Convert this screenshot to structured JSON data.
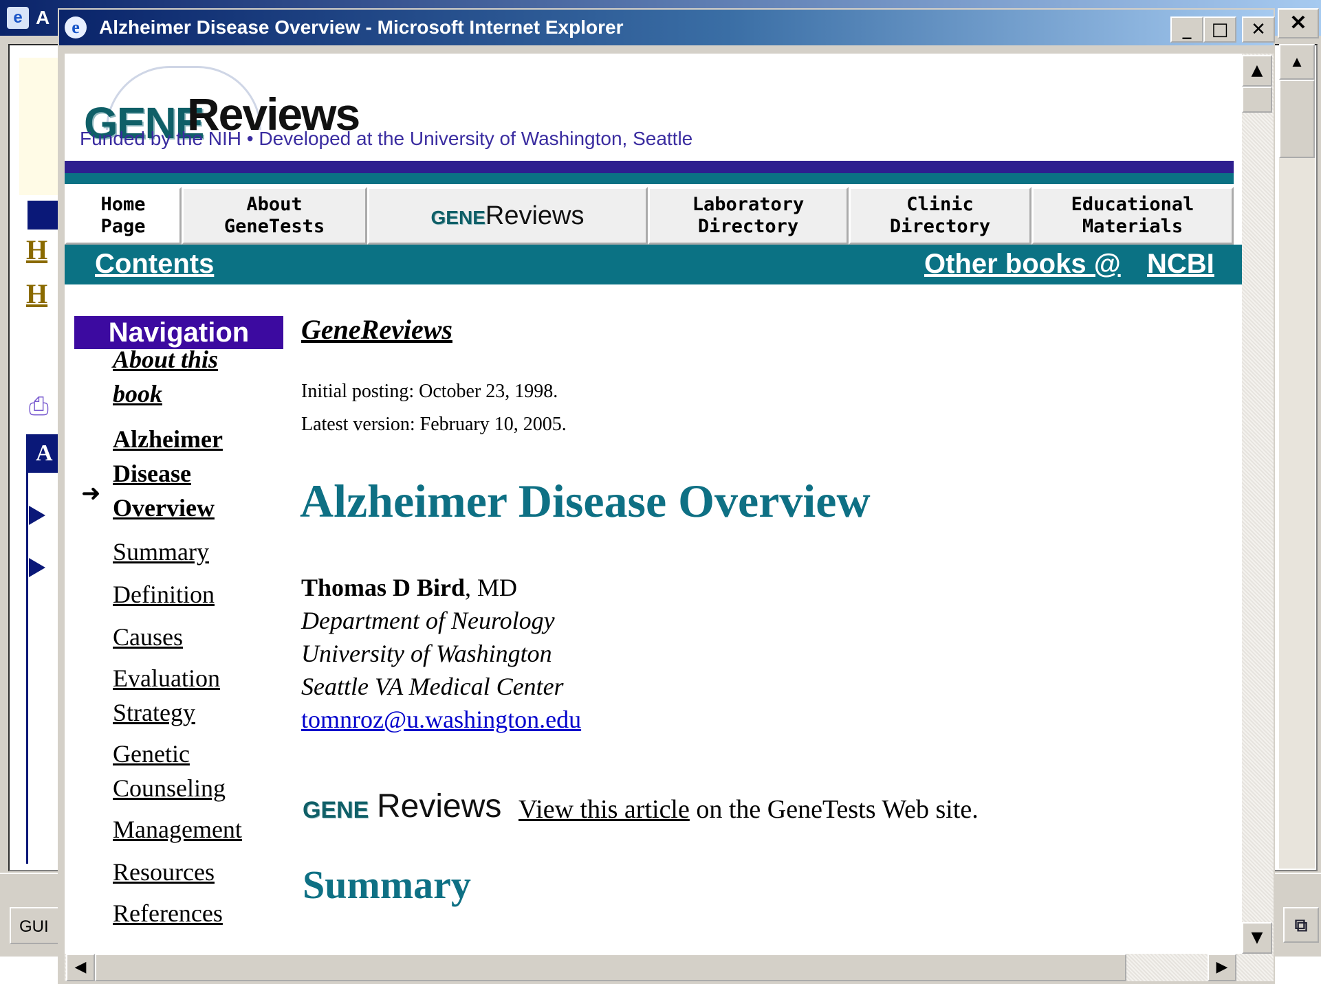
{
  "background_window": {
    "title_fragment": "A",
    "close_glyph": "✕",
    "links": [
      "H",
      "H"
    ],
    "panel_label": "A",
    "taskbar_button": "GUI"
  },
  "window": {
    "title": "Alzheimer Disease Overview - Microsoft Internet Explorer",
    "icon_glyph": "e",
    "min_glyph": "_",
    "max_glyph": "□",
    "close_glyph": "✕"
  },
  "banner": {
    "logo_gene": "GENE",
    "logo_reviews": "Reviews",
    "tagline": "Funded by the NIH  •  Developed at the University of Washington, Seattle"
  },
  "tabs": [
    {
      "line1": "Home",
      "line2": "Page"
    },
    {
      "line1": "About",
      "line2": "GeneTests"
    },
    {
      "logo_gene": "GENE",
      "logo_reviews": "Reviews"
    },
    {
      "line1": "Laboratory",
      "line2": "Directory"
    },
    {
      "line1": "Clinic",
      "line2": "Directory"
    },
    {
      "line1": "Educational",
      "line2": "Materials"
    }
  ],
  "contents_bar": {
    "contents": "Contents",
    "other_books": "Other books @",
    "ncbi": "NCBI"
  },
  "navigation": {
    "heading": "Navigation",
    "arrow": "➜",
    "items": [
      {
        "line1": "About this",
        "line2": "book"
      },
      {
        "line1": "Alzheimer",
        "line2": "Disease",
        "line3": "Overview"
      },
      {
        "line1": "Summary"
      },
      {
        "line1": "Definition"
      },
      {
        "line1": "Causes"
      },
      {
        "line1": "Evaluation",
        "line2": "Strategy"
      },
      {
        "line1": "Genetic",
        "line2": "Counseling"
      },
      {
        "line1": "Management"
      },
      {
        "line1": "Resources"
      },
      {
        "line1": "References"
      }
    ]
  },
  "article": {
    "brand": "GeneReviews",
    "initial_posting": "Initial posting: October 23, 1998.",
    "latest_version": "Latest version: February 10, 2005.",
    "title": "Alzheimer Disease Overview",
    "author_name": "Thomas D Bird",
    "author_suffix": ", MD",
    "affiliations": [
      "Department of Neurology",
      "University of Washington",
      "Seattle VA Medical Center"
    ],
    "email": "tomnroz@u.washington.edu",
    "genetests_logo_gene": "GENE",
    "genetests_logo_reviews": "Reviews",
    "view_link": "View this article",
    "view_rest": " on the GeneTests Web site.",
    "summary_heading": "Summary"
  },
  "scrollbars": {
    "up": "▲",
    "down": "▼",
    "left": "◀",
    "right": "▶"
  }
}
